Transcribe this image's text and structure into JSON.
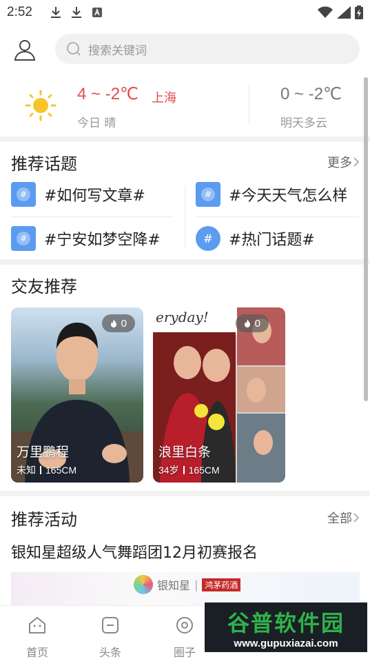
{
  "status_bar": {
    "time": "2:52"
  },
  "search": {
    "placeholder": "搜索关键词"
  },
  "weather": {
    "today_temp": "4 ~ -2℃",
    "city": "上海",
    "today_label": "今日 晴",
    "tomorrow_temp": "0 ~ -2℃",
    "tomorrow_label": "明天多云"
  },
  "topics": {
    "title": "推荐话题",
    "more": "更多",
    "items": [
      {
        "label": "#如何写文章#"
      },
      {
        "label": "#今天天气怎么样"
      },
      {
        "label": "#宁安如梦空降#"
      },
      {
        "label": "#热门话题#"
      }
    ]
  },
  "friends": {
    "title": "交友推荐",
    "cards": [
      {
        "name": "万里鹏程",
        "gender": "未知",
        "height": "165CM",
        "likes": "0"
      },
      {
        "name": "浪里白条",
        "age": "34岁",
        "height": "165CM",
        "likes": "0"
      }
    ],
    "photo_caption": "eryday!"
  },
  "activities": {
    "title": "推荐活动",
    "more": "全部",
    "item_title": "银知星超级人气舞蹈团12月初赛报名",
    "banner_brand": "银知星",
    "banner_tag": "鸿茅药酒"
  },
  "tabs": [
    {
      "label": "首页",
      "icon": "home-icon"
    },
    {
      "label": "头条",
      "icon": "headline-icon"
    },
    {
      "label": "圈子",
      "icon": "circle-icon"
    }
  ],
  "watermark": {
    "title": "谷普软件园",
    "url": "www.gupuxiazai.com"
  },
  "colors": {
    "accent_red": "#e5484d",
    "topic_blue": "#5b9bf0",
    "brand_green": "#2eb34a"
  }
}
